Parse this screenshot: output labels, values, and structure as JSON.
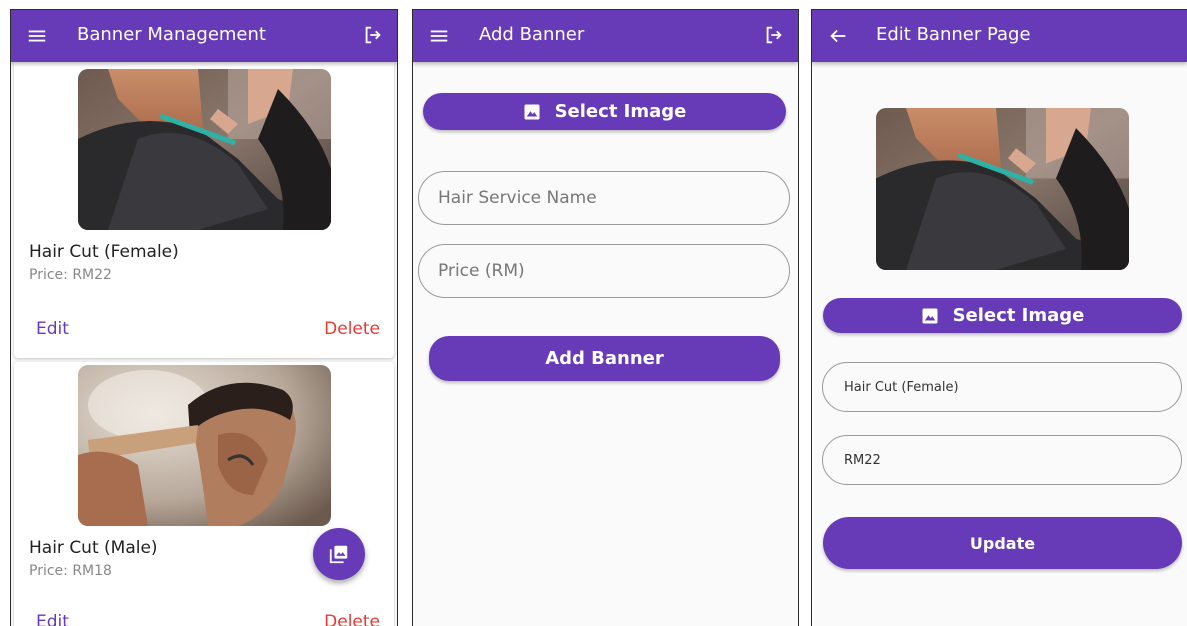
{
  "colors": {
    "primary": "#673ab7",
    "delete": "#e53935",
    "background": "#fafafa"
  },
  "banner_management": {
    "title": "Banner Management",
    "menu_icon": "menu-icon",
    "logout_icon": "logout-icon",
    "banners": [
      {
        "title": "Hair Cut (Female)",
        "price": "Price: RM22",
        "edit_label": "Edit",
        "delete_label": "Delete",
        "image": "female-haircut-photo"
      },
      {
        "title": "Hair Cut (Male)",
        "price": "Price: RM18",
        "edit_label": "Edit",
        "delete_label": "Delete",
        "image": "male-haircut-photo"
      }
    ],
    "fab_icon": "photo-library-icon"
  },
  "add_banner": {
    "title": "Add Banner",
    "menu_icon": "menu-icon",
    "logout_icon": "logout-icon",
    "select_image_label": "Select Image",
    "select_image_icon": "image-icon",
    "name_placeholder": "Hair Service Name",
    "price_placeholder": "Price (RM)",
    "submit_label": "Add Banner"
  },
  "edit_banner": {
    "title": "Edit Banner Page",
    "back_icon": "arrow-back-icon",
    "image": "female-haircut-photo",
    "select_image_label": "Select Image",
    "select_image_icon": "image-icon",
    "name_value": "Hair Cut (Female)",
    "price_value": "RM22",
    "submit_label": "Update"
  }
}
